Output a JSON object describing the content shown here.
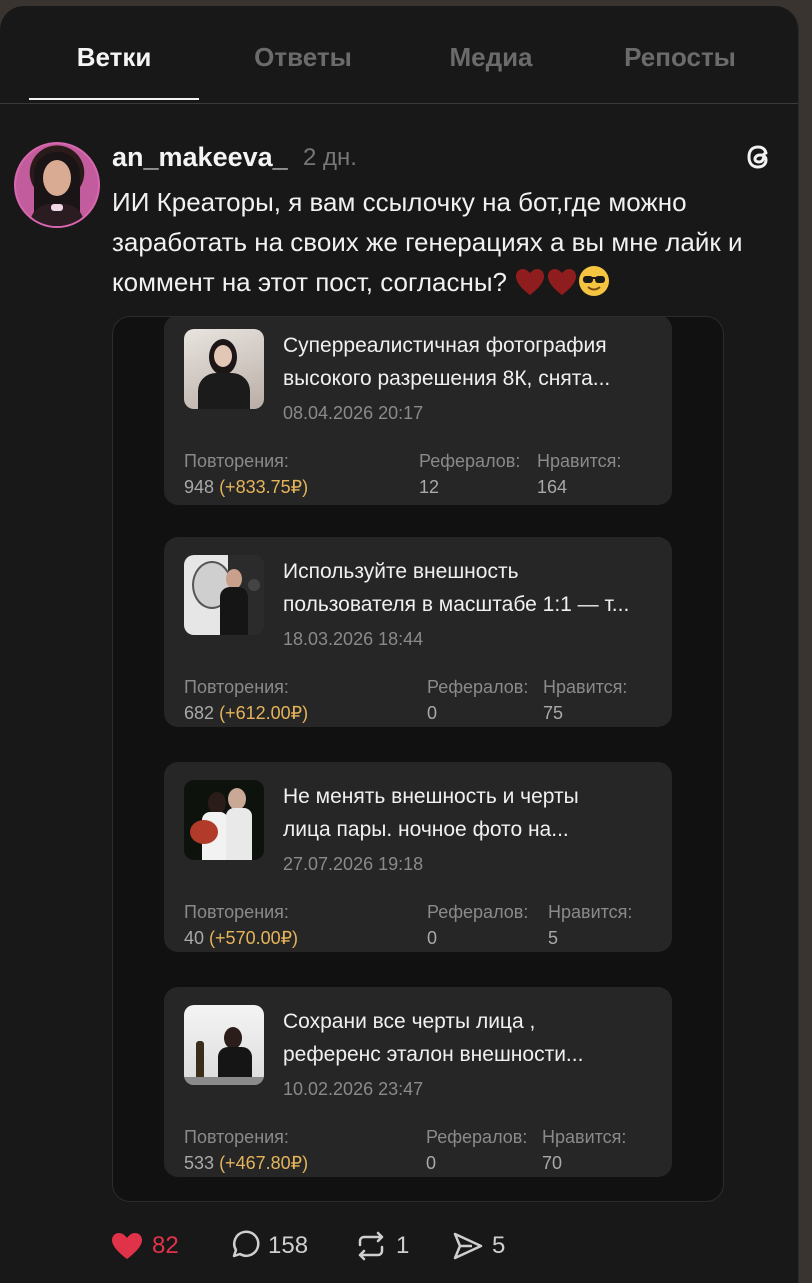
{
  "tabs": [
    {
      "label": "Ветки",
      "active": true
    },
    {
      "label": "Ответы",
      "active": false
    },
    {
      "label": "Медиа",
      "active": false
    },
    {
      "label": "Репосты",
      "active": false
    }
  ],
  "post": {
    "username": "an_makeeva_",
    "time": "2 дн.",
    "text": "ИИ Креаторы, я вам ссылочку на бот,где можно заработать на своих же генерациях а вы мне лайк и коммент на этот пост, согласны?",
    "emojis": [
      "heart-emoji",
      "heart-emoji",
      "sunglasses-emoji"
    ]
  },
  "embed": {
    "labels": {
      "repeats": "Повторения:",
      "referrals": "Рефералов:",
      "likes": "Нравится:"
    },
    "cards": [
      {
        "title_line1": "Суперреалистичная фотография",
        "title_line2": "высокого разрешения 8К, снята...",
        "date": "08.04.2026 20:17",
        "repeats": "948",
        "earn": "(+833.75₽)",
        "referrals": "12",
        "likes": "164"
      },
      {
        "title_line1": "Используйте внешность",
        "title_line2": "пользователя в масштабе 1:1 — т...",
        "date": "18.03.2026 18:44",
        "repeats": "682",
        "earn": "(+612.00₽)",
        "referrals": "0",
        "likes": "75"
      },
      {
        "title_line1": "Не менять внешность и черты",
        "title_line2": "лица пары. ночное фото на...",
        "date": "27.07.2026 19:18",
        "repeats": "40",
        "earn": "(+570.00₽)",
        "referrals": "0",
        "likes": "5"
      },
      {
        "title_line1": "Сохрани все черты лица ,",
        "title_line2": "референс эталон внешности...",
        "date": "10.02.2026 23:47",
        "repeats": "533",
        "earn": "(+467.80₽)",
        "referrals": "0",
        "likes": "70"
      }
    ]
  },
  "actions": {
    "likes": "82",
    "comments": "158",
    "reposts": "1",
    "shares": "5"
  },
  "colors": {
    "background": "#181818",
    "card": "#262626",
    "earnings": "#e5b45a",
    "like": "#e0334a"
  }
}
